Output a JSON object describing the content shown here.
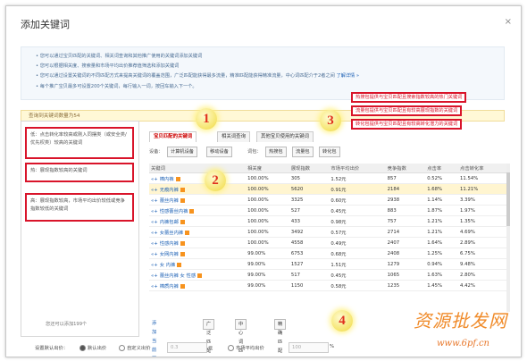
{
  "dialog": {
    "title": "添加关键词",
    "close": "×"
  },
  "tips": [
    "• 您可以通过宝贝匹配的关键词、相关词查询和其他推广使用的关键词添加关键词",
    "• 您可以根据相关度、搜索量和市场平均出价推荐值筛选和添加关键词",
    "• 您可以通过设置关键词的不同匹配方式来提高关键词的覆盖范围，广泛匹配能获得最多流量，精准匹配能获得精准流量，中心词匹配介于2者之间",
    "• 每个推广宝贝最多可设置200个关键词，每行输入一词，按回车输入下一个。"
  ],
  "tips_link": "了解详情 »",
  "query_bar": "查询到关键词数量为54",
  "left_panel": {
    "low_note": "低：点击转化率较高或刚入同摆类（或安全类/优先权类）较高的关键词",
    "hot_note": "热：展现指数较高的关键词",
    "high_note": "高：展现指数较高，市场平均出价较低或竞争指数较低的关键词",
    "limit_note": "您还可以添加199个"
  },
  "tabs": [
    "宝贝匹配的关键词",
    "相关词查询",
    "其他宝贝使用的关键词"
  ],
  "filter": {
    "label": "设备：",
    "btn1": "计算机设备",
    "btn2": "移动设备",
    "label2": "词包：",
    "btn3": "热搜包",
    "btn4": "流量包",
    "btn5": "转化包"
  },
  "table": {
    "headers": [
      "关键词",
      "相关度",
      "展现指数",
      "市场平均出价",
      "竞争指数",
      "点击率",
      "点击转化率"
    ],
    "rows": [
      {
        "kw": "棉内裤",
        "c": [
          "100.00%",
          "305",
          "1.52元",
          "857",
          "0.52%",
          "11.54%"
        ]
      },
      {
        "kw": "无痕内裤",
        "c": [
          "100.00%",
          "5620",
          "0.91元",
          "2184",
          "1.68%",
          "11.21%"
        ]
      },
      {
        "kw": "蕾丝内裤",
        "c": [
          "100.00%",
          "3325",
          "0.60元",
          "2938",
          "1.14%",
          "3.39%"
        ]
      },
      {
        "kw": "性感蕾丝内裤",
        "c": [
          "100.00%",
          "527",
          "0.45元",
          "883",
          "1.87%",
          "1.97%"
        ]
      },
      {
        "kw": "内裤包邮",
        "c": [
          "100.00%",
          "433",
          "0.98元",
          "757",
          "1.21%",
          "1.35%"
        ]
      },
      {
        "kw": "女蕾丝内裤",
        "c": [
          "100.00%",
          "3492",
          "0.57元",
          "2714",
          "1.21%",
          "4.69%"
        ]
      },
      {
        "kw": "性感内裤",
        "c": [
          "100.00%",
          "4558",
          "0.49元",
          "2407",
          "1.64%",
          "2.89%"
        ]
      },
      {
        "kw": "女网内裤",
        "c": [
          "99.00%",
          "6753",
          "0.68元",
          "2408",
          "1.25%",
          "6.75%"
        ]
      },
      {
        "kw": "女 内裤",
        "c": [
          "99.00%",
          "1527",
          "1.51元",
          "1279",
          "0.94%",
          "9.48%"
        ]
      },
      {
        "kw": "蕾丝内裤 女 性感",
        "c": [
          "99.00%",
          "517",
          "0.45元",
          "1065",
          "1.63%",
          "2.80%"
        ]
      },
      {
        "kw": "棉质内裤",
        "c": [
          "99.00%",
          "1150",
          "0.58元",
          "1235",
          "1.45%",
          "4.42%"
        ]
      }
    ]
  },
  "bottom": {
    "add_page": "添加当前页",
    "b1": "广泛匹配",
    "b2": "中心词匹配",
    "b3": "精确匹配"
  },
  "bid": {
    "label": "设置默认出价：",
    "r1": "默认出价",
    "r2": "自定义出价",
    "v1": "0.3",
    "unit": "元",
    "r3": "市场平均出价",
    "v2": "100",
    "unit2": "%"
  },
  "callouts": {
    "c1": "热搜包提供与宝贝匹配且搜索指数较高的热门关键词",
    "c2": "流量包提供与宝贝匹配且有较高展现指数的关键词",
    "c3": "转化包提供与宝贝匹配且有较高转化潜力的关键词"
  },
  "badges": [
    "1",
    "2",
    "3",
    "4"
  ],
  "watermark": "资源批发网",
  "watermark_url": "www.6pf.cn"
}
